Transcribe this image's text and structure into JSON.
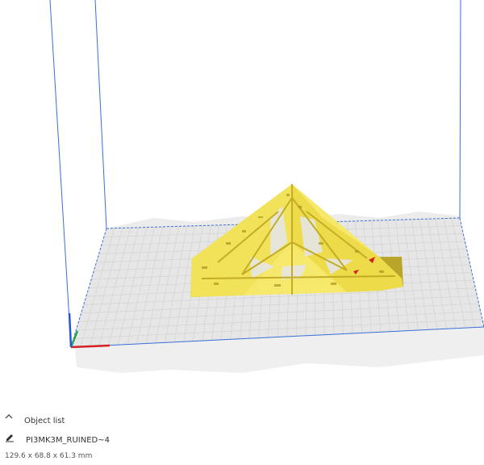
{
  "object_panel": {
    "toggle_label": "Object list",
    "object_name": "PI3MK3M_RUINED~4",
    "dimensions": "129.6 x 68.8 x 61.3 mm"
  },
  "colors": {
    "model_yellow": "#f2e25a",
    "model_shadow": "#b8a52a",
    "build_plate": "#e6e6e6",
    "grid_lines": "#cfcfcf",
    "frame_blue": "#3a6fd8",
    "axis_x_red": "#d42020",
    "axis_y_green": "#27a84a",
    "axis_z_blue": "#2a55d8"
  },
  "icons": {
    "toggle": "chevron-up-icon",
    "object": "pencil-icon"
  }
}
